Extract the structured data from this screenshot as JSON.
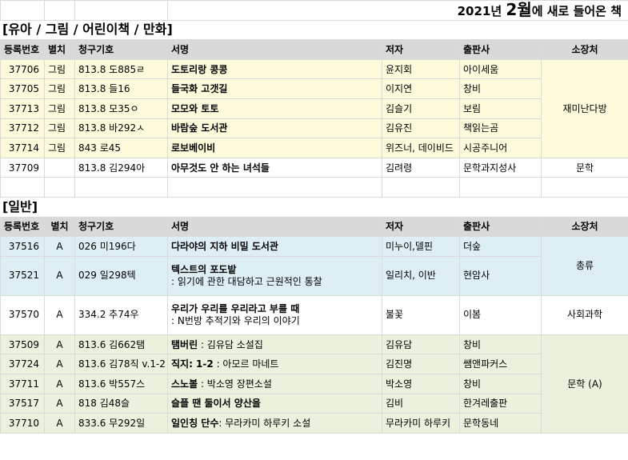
{
  "title": {
    "prefix": "2021년 ",
    "month": "2월",
    "suffix": "에 새로 들어온 책"
  },
  "columns": {
    "reg": "등록번호",
    "sep": "별치",
    "call": "청구기호",
    "title": "서명",
    "author": "저자",
    "publisher": "출판사",
    "location": "소장처"
  },
  "section_children": {
    "label": "[유아 / 그림 / 어린이책 / 만화]",
    "rows": [
      {
        "reg": "37706",
        "sep": "그림",
        "call": "813.8 도885ㄹ",
        "title": "도토리랑 콩콩",
        "author": "윤지회",
        "publisher": "아이세움"
      },
      {
        "reg": "37705",
        "sep": "그림",
        "call": "813.8 들16",
        "title": "들국화 고갯길",
        "author": "이지연",
        "publisher": "창비"
      },
      {
        "reg": "37713",
        "sep": "그림",
        "call": "813.8 모35ㅇ",
        "title": "모모와 토토",
        "author": "김슬기",
        "publisher": "보림"
      },
      {
        "reg": "37712",
        "sep": "그림",
        "call": "813.8 바292ㅅ",
        "title": "바람숲 도서관",
        "author": "김유진",
        "publisher": "책읽는곰"
      },
      {
        "reg": "37714",
        "sep": "그림",
        "call": "843 로45",
        "title": "로보베이비",
        "author": "위즈너, 데이비드",
        "publisher": "시공주니어"
      }
    ],
    "group_location": "재미난다방",
    "extra": {
      "reg": "37709",
      "sep": "",
      "call": "813.8 김294아",
      "title": "아무것도 안 하는 녀석들",
      "author": "김려령",
      "publisher": "문학과지성사",
      "location": "문학"
    }
  },
  "section_general": {
    "label": "[일반]",
    "blue": {
      "location": "총류",
      "rows": [
        {
          "reg": "37516",
          "sep": "A",
          "call": "026 미196다",
          "title": "다라야의 지하 비밀 도서관",
          "sub": "",
          "author": "미누이,델핀",
          "publisher": "더숲"
        },
        {
          "reg": "37521",
          "sep": "A",
          "call": "029 일298텍",
          "title": "텍스트의 포도밭",
          "sub": "  : 읽기에 관한 대담하고 근원적인 통찰",
          "author": "일리치, 이반",
          "publisher": "현암사"
        }
      ]
    },
    "social": {
      "reg": "37570",
      "sep": "A",
      "call": "334.2 추74우",
      "title": "우리가 우리를 우리라고 부를 때",
      "sub": "  : N번방 추적기와 우리의 이야기",
      "author": "불꽃",
      "publisher": "이봄",
      "location": "사회과학"
    },
    "green": {
      "location": "문학 (A)",
      "rows": [
        {
          "reg": "37509",
          "sep": "A",
          "call": "813.6 김662탬",
          "title": "탬버린",
          "rest": " : 김유담 소설집",
          "author": "김유담",
          "publisher": "창비"
        },
        {
          "reg": "37724",
          "sep": "A",
          "call": "813.6 김78직 v.1-2",
          "title": "직지: 1-2",
          "rest": " : 아모르 마네트",
          "author": "김진명",
          "publisher": "쌤앤파커스"
        },
        {
          "reg": "37711",
          "sep": "A",
          "call": "813.6 박557스",
          "title": "스노볼",
          "rest": " : 박소영 장편소설",
          "author": "박소영",
          "publisher": "창비"
        },
        {
          "reg": "37517",
          "sep": "A",
          "call": "818 김48슬",
          "title": "슬플 땐 둘이서 양산을",
          "rest": "",
          "author": "김비",
          "publisher": "한겨레출판"
        },
        {
          "reg": "37710",
          "sep": "A",
          "call": "833.6 무292일",
          "title": "일인칭 단수",
          "rest": ": 무라카미 하루키 소설",
          "author": "무라카미 하루키",
          "publisher": "문학동네"
        }
      ]
    }
  }
}
